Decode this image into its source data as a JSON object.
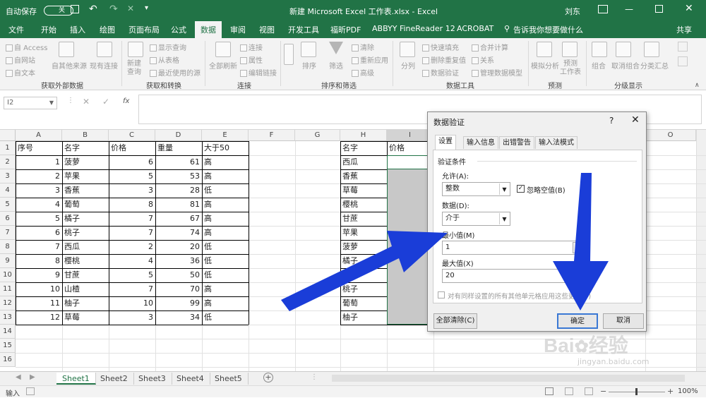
{
  "titlebar": {
    "autosave": "自动保存",
    "autosave_toggle": "关",
    "title": "新建 Microsoft Excel 工作表.xlsx  -  Excel",
    "user": "刘东"
  },
  "tabs": [
    "文件",
    "开始",
    "插入",
    "绘图",
    "页面布局",
    "公式",
    "数据",
    "审阅",
    "视图",
    "开发工具",
    "福昕PDF",
    "ABBYY FineReader 12",
    "ACROBAT"
  ],
  "active_tab": "数据",
  "tellme": "告诉我你想要做什么",
  "share": "共享",
  "ribbon": {
    "ext": {
      "access": "自 Access",
      "web": "自网站",
      "text": "自文本",
      "other": "自其他来源",
      "existing": "现有连接",
      "group": "获取外部数据"
    },
    "transform": {
      "new_query": "新建\n查询",
      "show_query": "显示查询",
      "from_table": "从表格",
      "recent": "最近使用的源",
      "group": "获取和转换"
    },
    "conn": {
      "refresh": "全部刷新",
      "connections": "连接",
      "properties": "属性",
      "edit_links": "编辑链接",
      "group": "连接"
    },
    "sort": {
      "sort": "排序",
      "filter": "筛选",
      "clear": "清除",
      "reapply": "重新应用",
      "advanced": "高级",
      "group": "排序和筛选"
    },
    "tools": {
      "split": "分列",
      "flash": "快速填充",
      "remove_dup": "删除重复值",
      "validation": "数据验证",
      "consolidate": "合并计算",
      "relations": "关系",
      "model": "管理数据模型",
      "group": "数据工具"
    },
    "forecast": {
      "whatif": "模拟分析",
      "sheet": "预测\n工作表",
      "group": "预测"
    },
    "outline": {
      "group_btn": "组合",
      "ungroup": "取消组合",
      "subtotal": "分类汇总",
      "group": "分级显示"
    }
  },
  "formula": {
    "namebox": "I2",
    "fx": "fx"
  },
  "columns": [
    "A",
    "B",
    "C",
    "D",
    "E",
    "F",
    "G",
    "H",
    "I",
    "O"
  ],
  "rows": [
    "1",
    "2",
    "3",
    "4",
    "5",
    "6",
    "7",
    "8",
    "9",
    "10",
    "11",
    "12",
    "13",
    "14",
    "15",
    "16"
  ],
  "table": {
    "headers": [
      "序号",
      "名字",
      "价格",
      "重量",
      "大于50"
    ],
    "rows": [
      [
        "1",
        "菠萝",
        "6",
        "61",
        "高"
      ],
      [
        "2",
        "苹果",
        "5",
        "53",
        "高"
      ],
      [
        "3",
        "香蕉",
        "3",
        "28",
        "低"
      ],
      [
        "4",
        "葡萄",
        "8",
        "81",
        "高"
      ],
      [
        "5",
        "橘子",
        "7",
        "67",
        "高"
      ],
      [
        "6",
        "桃子",
        "7",
        "74",
        "高"
      ],
      [
        "7",
        "西瓜",
        "2",
        "20",
        "低"
      ],
      [
        "8",
        "樱桃",
        "4",
        "36",
        "低"
      ],
      [
        "9",
        "甘蔗",
        "5",
        "50",
        "低"
      ],
      [
        "10",
        "山楂",
        "7",
        "70",
        "高"
      ],
      [
        "11",
        "柚子",
        "10",
        "99",
        "高"
      ],
      [
        "12",
        "草莓",
        "3",
        "34",
        "低"
      ]
    ]
  },
  "table2": {
    "headers": [
      "名字",
      "价格"
    ],
    "names": [
      "西瓜",
      "香蕉",
      "草莓",
      "樱桃",
      "甘蔗",
      "苹果",
      "菠萝",
      "橘子",
      "山楂",
      "桃子",
      "葡萄",
      "柚子"
    ]
  },
  "dialog": {
    "title": "数据验证",
    "help": "?",
    "tabs": [
      "设置",
      "输入信息",
      "出错警告",
      "输入法模式"
    ],
    "criteria": "验证条件",
    "allow_label": "允许(A):",
    "allow_value": "整数",
    "ignore_blank": "忽略空值(B)",
    "data_label": "数据(D):",
    "data_value": "介于",
    "min_label": "最小值(M)",
    "min_value": "1",
    "max_label": "最大值(X)",
    "max_value": "20",
    "apply_all": "对有同样设置的所有其他单元格应用这些更改(P)",
    "clear_all": "全部清除(C)",
    "ok": "确定",
    "cancel": "取消"
  },
  "sheets": [
    "Sheet1",
    "Sheet2",
    "Sheet3",
    "Sheet4",
    "Sheet5"
  ],
  "status": {
    "mode": "输入",
    "zoom": "100%"
  },
  "watermark": {
    "brand": "Bai",
    "brand2": "经验",
    "url": "jingyan.baidu.com"
  },
  "colors": {
    "excel_green": "#217346",
    "arrow_blue": "#1a3dd8",
    "selection_gray": "#c8c8c8"
  }
}
